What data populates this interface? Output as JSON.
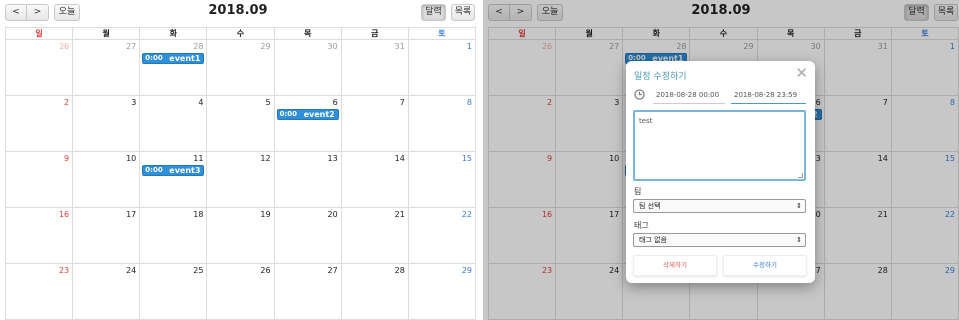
{
  "toolbar": {
    "prev_icon": "chevron-left-icon",
    "next_icon": "chevron-right-icon",
    "prev_label": "<",
    "next_label": ">",
    "today_label": "오늘",
    "month_label": "달력",
    "list_label": "목록"
  },
  "title": "2018.09",
  "weekdays": [
    "일",
    "월",
    "화",
    "수",
    "목",
    "금",
    "토"
  ],
  "weeks": [
    [
      "26",
      "27",
      "28",
      "29",
      "30",
      "31",
      "1"
    ],
    [
      "2",
      "3",
      "4",
      "5",
      "6",
      "7",
      "8"
    ],
    [
      "9",
      "10",
      "11",
      "12",
      "13",
      "14",
      "15"
    ],
    [
      "16",
      "17",
      "18",
      "19",
      "20",
      "21",
      "22"
    ],
    [
      "23",
      "24",
      "25",
      "26",
      "27",
      "28",
      "29"
    ]
  ],
  "events": [
    {
      "week": 0,
      "day": 2,
      "time": "0:00",
      "title": "event1"
    },
    {
      "week": 1,
      "day": 4,
      "time": "0:00",
      "title": "event2"
    },
    {
      "week": 2,
      "day": 2,
      "time": "0:00",
      "title": "event3"
    }
  ],
  "modal": {
    "title": "일정 수정하기",
    "close_label": "✕",
    "start": "2018-08-28 00:00",
    "end": "2018-08-28 23:59",
    "memo": "test",
    "team_label": "팀",
    "team_value": "팀 선택",
    "tag_label": "태그",
    "tag_value": "태그 없음",
    "delete_label": "삭제하기",
    "save_label": "수정하기"
  },
  "colors": {
    "accent": "#2f8fd8",
    "sunday": "#e03c3c",
    "saturday": "#3b7ddd",
    "modal_title": "#4a9bb5"
  }
}
